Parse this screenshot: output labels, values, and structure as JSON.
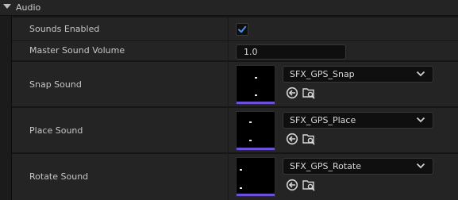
{
  "section": {
    "title": "Audio"
  },
  "rows": {
    "sounds_enabled": {
      "label": "Sounds Enabled",
      "checked": true
    },
    "master_volume": {
      "label": "Master Sound Volume",
      "value": "1.0"
    },
    "snap_sound": {
      "label": "Snap Sound",
      "asset": "SFX_GPS_Snap"
    },
    "place_sound": {
      "label": "Place Sound",
      "asset": "SFX_GPS_Place"
    },
    "rotate_sound": {
      "label": "Rotate Sound",
      "asset": "SFX_GPS_Rotate"
    }
  },
  "icons": {
    "collapse": "triangle-down-icon",
    "check": "checkmark-icon",
    "dropdown": "chevron-down-icon",
    "use_selected": "arrow-left-circle-icon",
    "browse": "folder-search-icon"
  },
  "colors": {
    "accent": "#6d50d8",
    "check": "#4a90f0",
    "panel": "#242424",
    "background": "#151515"
  }
}
